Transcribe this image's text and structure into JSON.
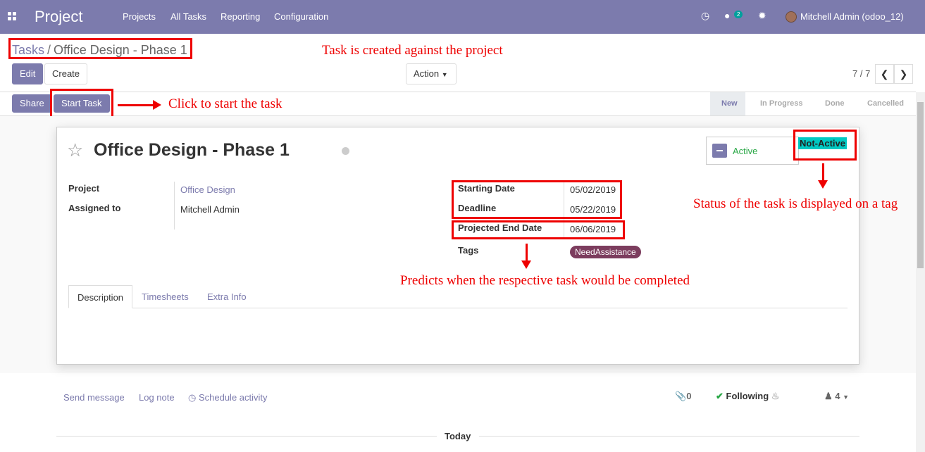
{
  "topbar": {
    "app_title": "Project",
    "menu": [
      "Projects",
      "All Tasks",
      "Reporting",
      "Configuration"
    ],
    "message_count": "2",
    "user": "Mitchell Admin (odoo_12)"
  },
  "breadcrumb": {
    "parent": "Tasks",
    "separator": "/",
    "current": "Office Design - Phase 1"
  },
  "control": {
    "edit": "Edit",
    "create": "Create",
    "action": "Action",
    "pager": "7 / 7"
  },
  "statusbar": {
    "share": "Share",
    "start_task": "Start Task",
    "stages": [
      "New",
      "In Progress",
      "Done",
      "Cancelled"
    ]
  },
  "task": {
    "title": "Office Design - Phase 1",
    "active_label": "Active",
    "status_tag": "Not-Active",
    "project_label": "Project",
    "project": "Office Design",
    "assigned_label": "Assigned to",
    "assigned": "Mitchell Admin",
    "start_label": "Starting Date",
    "start": "05/02/2019",
    "deadline_label": "Deadline",
    "deadline": "05/22/2019",
    "projected_label": "Projected End Date",
    "projected": "06/06/2019",
    "tags_label": "Tags",
    "tag": "NeedAssistance"
  },
  "tabs": [
    "Description",
    "Timesheets",
    "Extra Info"
  ],
  "chatter": {
    "send": "Send message",
    "log": "Log note",
    "schedule": "Schedule activity",
    "attachments": "0",
    "following": "Following",
    "followers": "4",
    "today": "Today"
  },
  "annotations": {
    "project": "Task is created against the project",
    "start": "Click to start the task",
    "status": "Status of the task is displayed on a tag",
    "predict": "Predicts when the respective task would be completed"
  },
  "colors": {
    "brand": "#7c7bad",
    "annotation": "#e00000",
    "status_tag": "#00c9c3",
    "tag_pill": "#7c3d5e"
  }
}
